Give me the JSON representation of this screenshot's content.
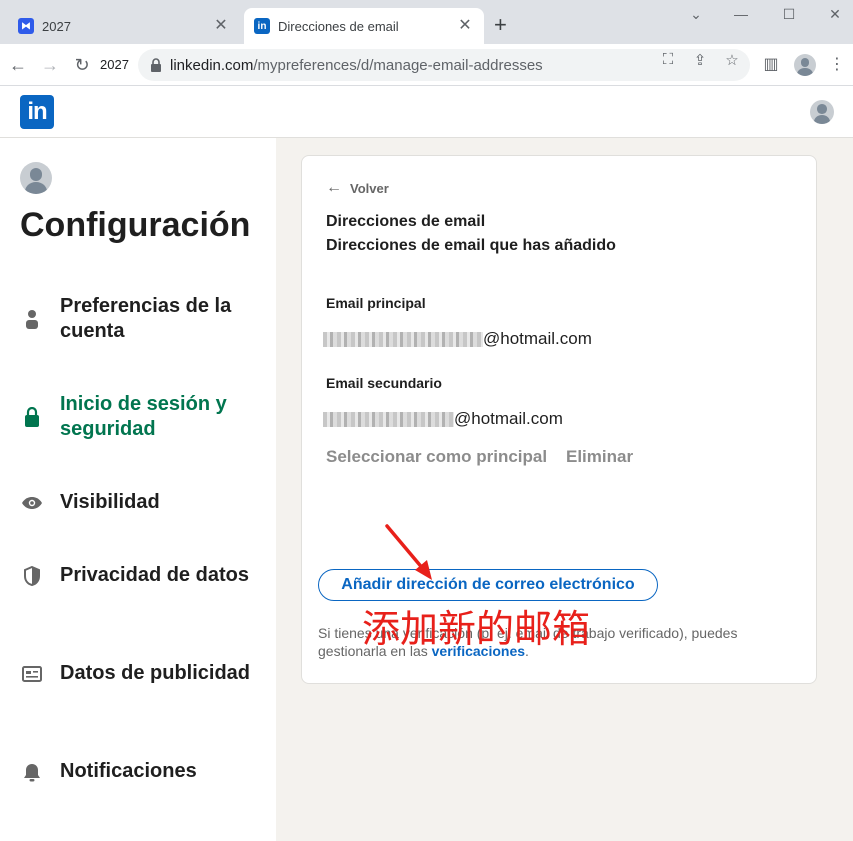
{
  "browser": {
    "tabs": [
      {
        "title": "2027",
        "active": false
      },
      {
        "title": "Direcciones de email",
        "active": true
      }
    ],
    "reload_label": "2027",
    "url_host": "linkedin.com",
    "url_path": "/mypreferences/d/manage-email-addresses"
  },
  "header": {
    "logo_text": "in"
  },
  "sidebar": {
    "title": "Configuración",
    "items": [
      {
        "label": "Preferencias de la cuenta",
        "icon": "person-icon",
        "active": false
      },
      {
        "label": "Inicio de sesión y seguridad",
        "icon": "lock-icon",
        "active": true
      },
      {
        "label": "Visibilidad",
        "icon": "eye-icon",
        "active": false
      },
      {
        "label": "Privacidad de datos",
        "icon": "shield-icon",
        "active": false
      },
      {
        "label": "Datos de publicidad",
        "icon": "ad-card-icon",
        "active": false
      },
      {
        "label": "Notificaciones",
        "icon": "bell-icon",
        "active": false
      }
    ]
  },
  "card": {
    "back_label": "Volver",
    "title": "Direcciones de email",
    "subtitle": "Direcciones de email que has añadido",
    "primary": {
      "label": "Email principal",
      "domain": "@hotmail.com"
    },
    "secondary": {
      "label": "Email secundario",
      "domain": "@hotmail.com"
    },
    "make_primary_label": "Seleccionar como principal",
    "remove_label": "Eliminar",
    "add_button_label": "Añadir dirección de correo electrónico",
    "note_prefix": "Si tienes una verificación (p. ej. email de trabajo verificado), puedes gestionarla en las ",
    "note_link": "verificaciones",
    "note_suffix": "."
  },
  "annotation": {
    "text": "添加新的邮箱",
    "color": "#e8201a"
  },
  "colors": {
    "linkedin_blue": "#0a66c2",
    "active_green": "#01754f"
  }
}
